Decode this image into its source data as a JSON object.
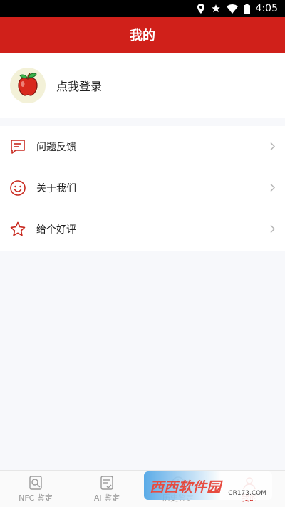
{
  "status_bar": {
    "time": "4:05",
    "icons": [
      "location-icon",
      "star-icon",
      "wifi-icon",
      "battery-icon"
    ]
  },
  "app_bar": {
    "title": "我的"
  },
  "login": {
    "label": "点我登录",
    "avatar": "apple-icon"
  },
  "menu": {
    "items": [
      {
        "label": "问题反馈",
        "icon": "feedback-icon"
      },
      {
        "label": "关于我们",
        "icon": "smile-icon"
      },
      {
        "label": "给个好评",
        "icon": "star-outline-icon"
      }
    ]
  },
  "tab_bar": {
    "tabs": [
      {
        "label": "NFC 鉴定",
        "icon": "nfc-scan-icon"
      },
      {
        "label": "AI 鉴定",
        "icon": "ai-doc-icon"
      },
      {
        "label": "历史鉴定",
        "icon": "history-icon"
      },
      {
        "label": "我的",
        "icon": "profile-icon"
      }
    ],
    "active_index": 3
  },
  "watermark": {
    "text": "西西软件园",
    "sub": "CR173.COM"
  },
  "colors": {
    "accent": "#d0201a",
    "background": "#f7f8fb"
  }
}
